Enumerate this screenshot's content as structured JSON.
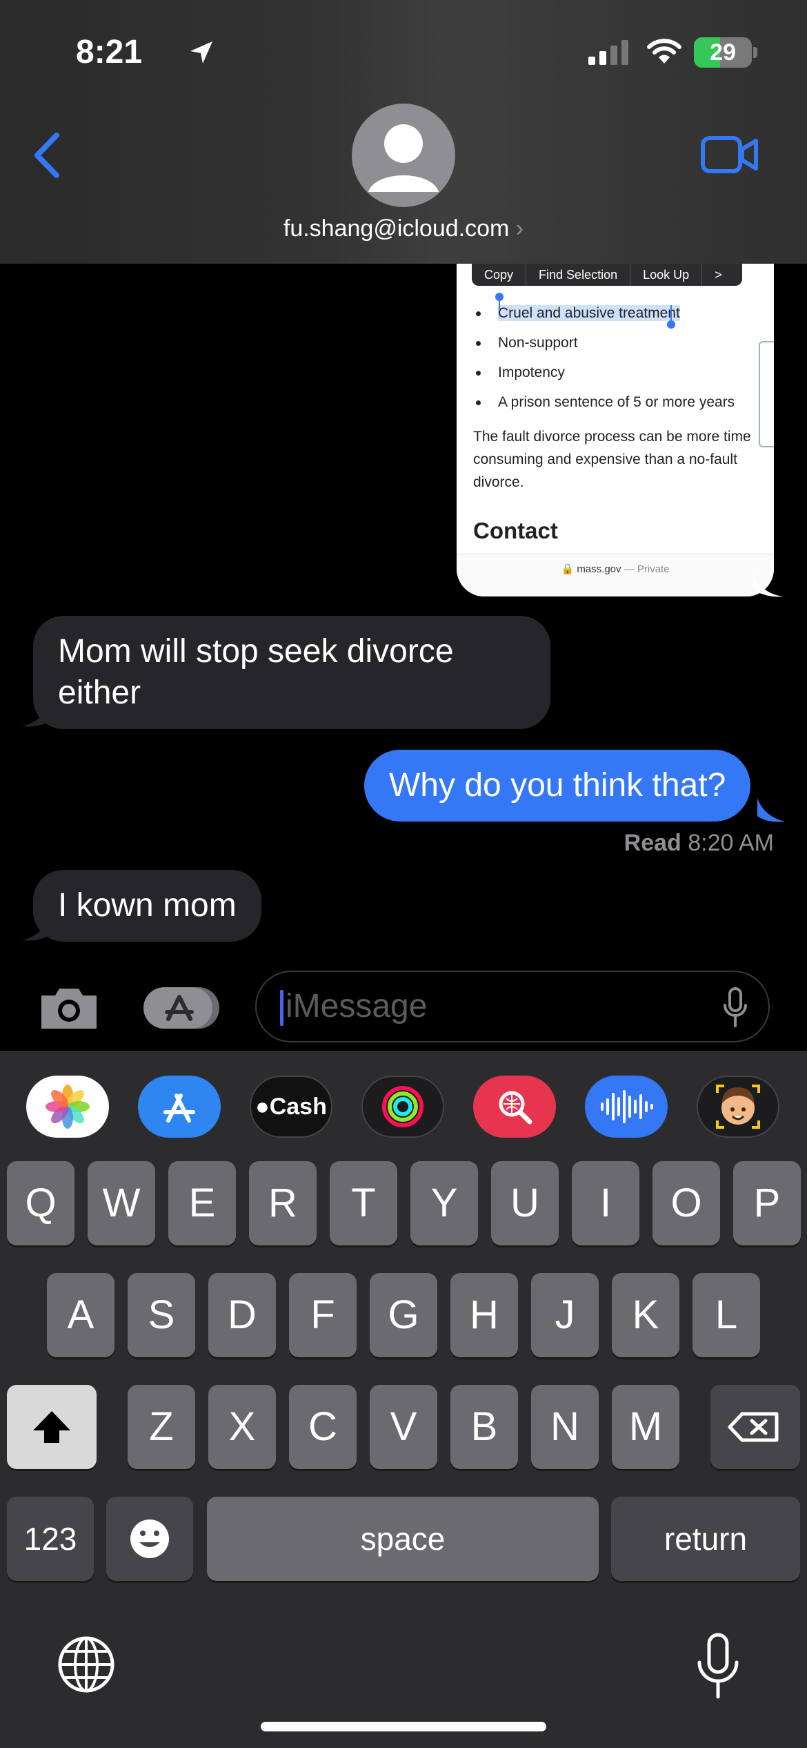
{
  "status": {
    "time": "8:21",
    "battery": "29"
  },
  "header": {
    "contact": "fu.shang@icloud.com"
  },
  "screenshot": {
    "menu": [
      "Copy",
      "Find Selection",
      "Look Up",
      ">"
    ],
    "bullets": [
      "Cruel and abusive treatment",
      "Non-support",
      "Impotency",
      "A prison sentence of 5 or more years"
    ],
    "paragraph": "The fault divorce process can be more time consuming and expensive than a no-fault divorce.",
    "heading": "Contact",
    "url": "mass.gov",
    "url_suffix": "— Private"
  },
  "messages": [
    {
      "from": "them",
      "text": "Mom will stop seek divorce either"
    },
    {
      "from": "me",
      "text": "Why do you think that?"
    },
    {
      "from": "them",
      "text": "I kown mom"
    }
  ],
  "read_receipt": {
    "label": "Read",
    "time": "8:20 AM"
  },
  "composer": {
    "placeholder": "iMessage"
  },
  "app_strip": [
    "photos-icon",
    "app-store-icon",
    "apple-cash-icon",
    "activity-icon",
    "image-search-icon",
    "audio-message-icon",
    "memoji-icon"
  ],
  "cash_label": "Cash",
  "keyboard": {
    "row1": [
      "Q",
      "W",
      "E",
      "R",
      "T",
      "Y",
      "U",
      "I",
      "O",
      "P"
    ],
    "row2": [
      "A",
      "S",
      "D",
      "F",
      "G",
      "H",
      "J",
      "K",
      "L"
    ],
    "row3": [
      "Z",
      "X",
      "C",
      "V",
      "B",
      "N",
      "M"
    ],
    "numbers": "123",
    "space": "space",
    "return": "return"
  },
  "colors": {
    "accent": "#3478f6",
    "incoming": "#26262a",
    "keyboard_bg": "#2c2c2e",
    "key": "#6b6b6f"
  }
}
